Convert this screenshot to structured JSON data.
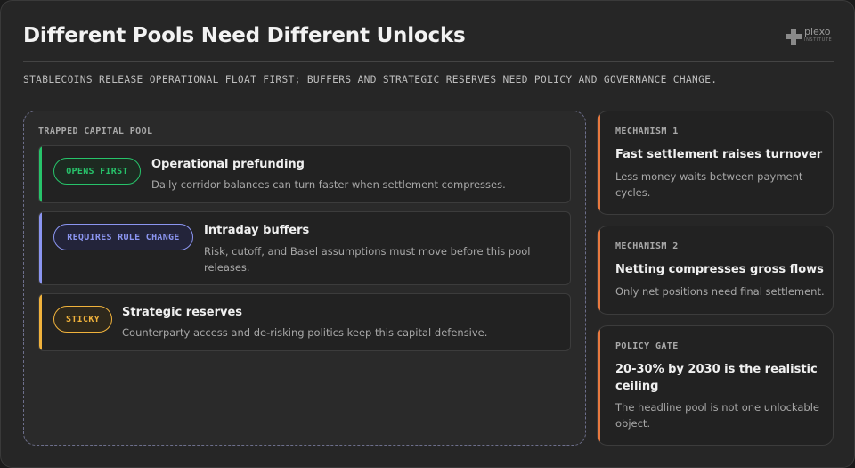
{
  "header": {
    "title": "Different Pools Need Different Unlocks",
    "subtitle": "STABLECOINS RELEASE OPERATIONAL FLOAT FIRST; BUFFERS AND STRATEGIC RESERVES NEED POLICY AND GOVERNANCE CHANGE.",
    "logo_word": "plexo",
    "logo_sub": "INSTITUTE"
  },
  "pool": {
    "label": "TRAPPED CAPITAL POOL",
    "rows": [
      {
        "badge": "OPENS FIRST",
        "title": "Operational prefunding",
        "description": "Daily corridor balances can turn faster when settlement compresses.",
        "color": "#27c36a"
      },
      {
        "badge": "REQUIRES RULE CHANGE",
        "title": "Intraday buffers",
        "description": "Risk, cutoff, and Basel assumptions must move before this pool releases.",
        "color": "#8b95f0"
      },
      {
        "badge": "STICKY",
        "title": "Strategic reserves",
        "description": "Counterparty access and de-risking politics keep this capital defensive.",
        "color": "#f0b23c"
      }
    ]
  },
  "cards": [
    {
      "label": "MECHANISM 1",
      "title": "Fast settlement raises turnover",
      "description": "Less money waits between payment cycles."
    },
    {
      "label": "MECHANISM 2",
      "title": "Netting compresses gross flows",
      "description": "Only net positions need final settlement."
    },
    {
      "label": "POLICY GATE",
      "title": "20-30% by 2030 is the realistic ceiling",
      "description": "The headline pool is not one unlockable object."
    }
  ],
  "colors": {
    "accent_orange": "#e8793f",
    "background": "#262626"
  }
}
